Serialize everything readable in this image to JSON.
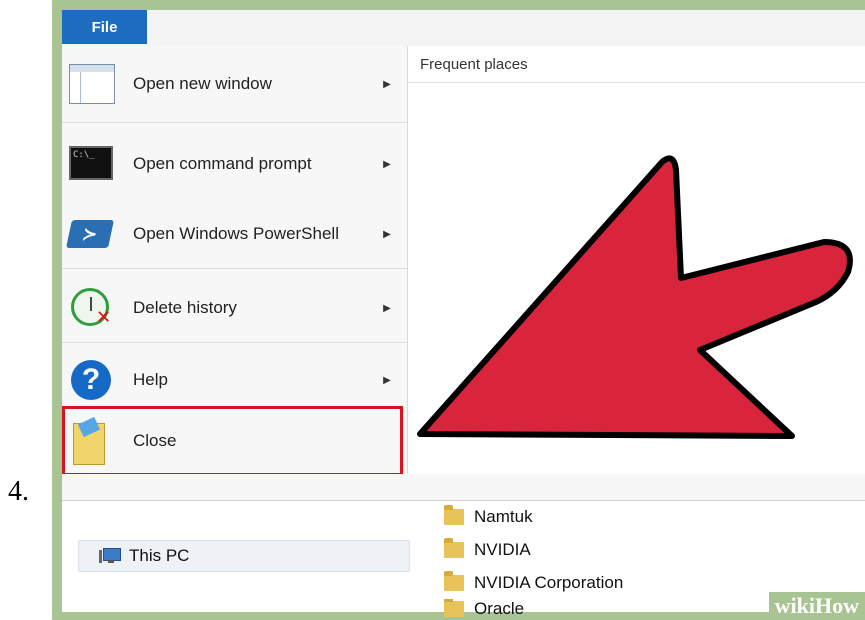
{
  "step_number": "4.",
  "file_tab": "File",
  "menu": {
    "items": [
      {
        "label": "Open new window",
        "icon": "window-icon"
      },
      {
        "label": "Open command prompt",
        "icon": "command-prompt-icon"
      },
      {
        "label": "Open Windows PowerShell",
        "icon": "powershell-icon"
      },
      {
        "label": "Delete history",
        "icon": "delete-history-icon"
      },
      {
        "label": "Help",
        "icon": "help-icon"
      },
      {
        "label": "Close",
        "icon": "close-icon"
      }
    ],
    "cmd_icon_text": "C:\\_"
  },
  "frequent_places_label": "Frequent places",
  "nav": {
    "this_pc": "This PC"
  },
  "folders": [
    {
      "name": "Namtuk"
    },
    {
      "name": "NVIDIA"
    },
    {
      "name": "NVIDIA Corporation"
    },
    {
      "name": "Oracle"
    }
  ],
  "watermark": "wikiHow",
  "colors": {
    "frame": "#a9c493",
    "file_tab": "#1d6cc0",
    "highlight": "#d9131b",
    "arrow_fill": "#d9253c",
    "arrow_stroke": "#000000"
  }
}
